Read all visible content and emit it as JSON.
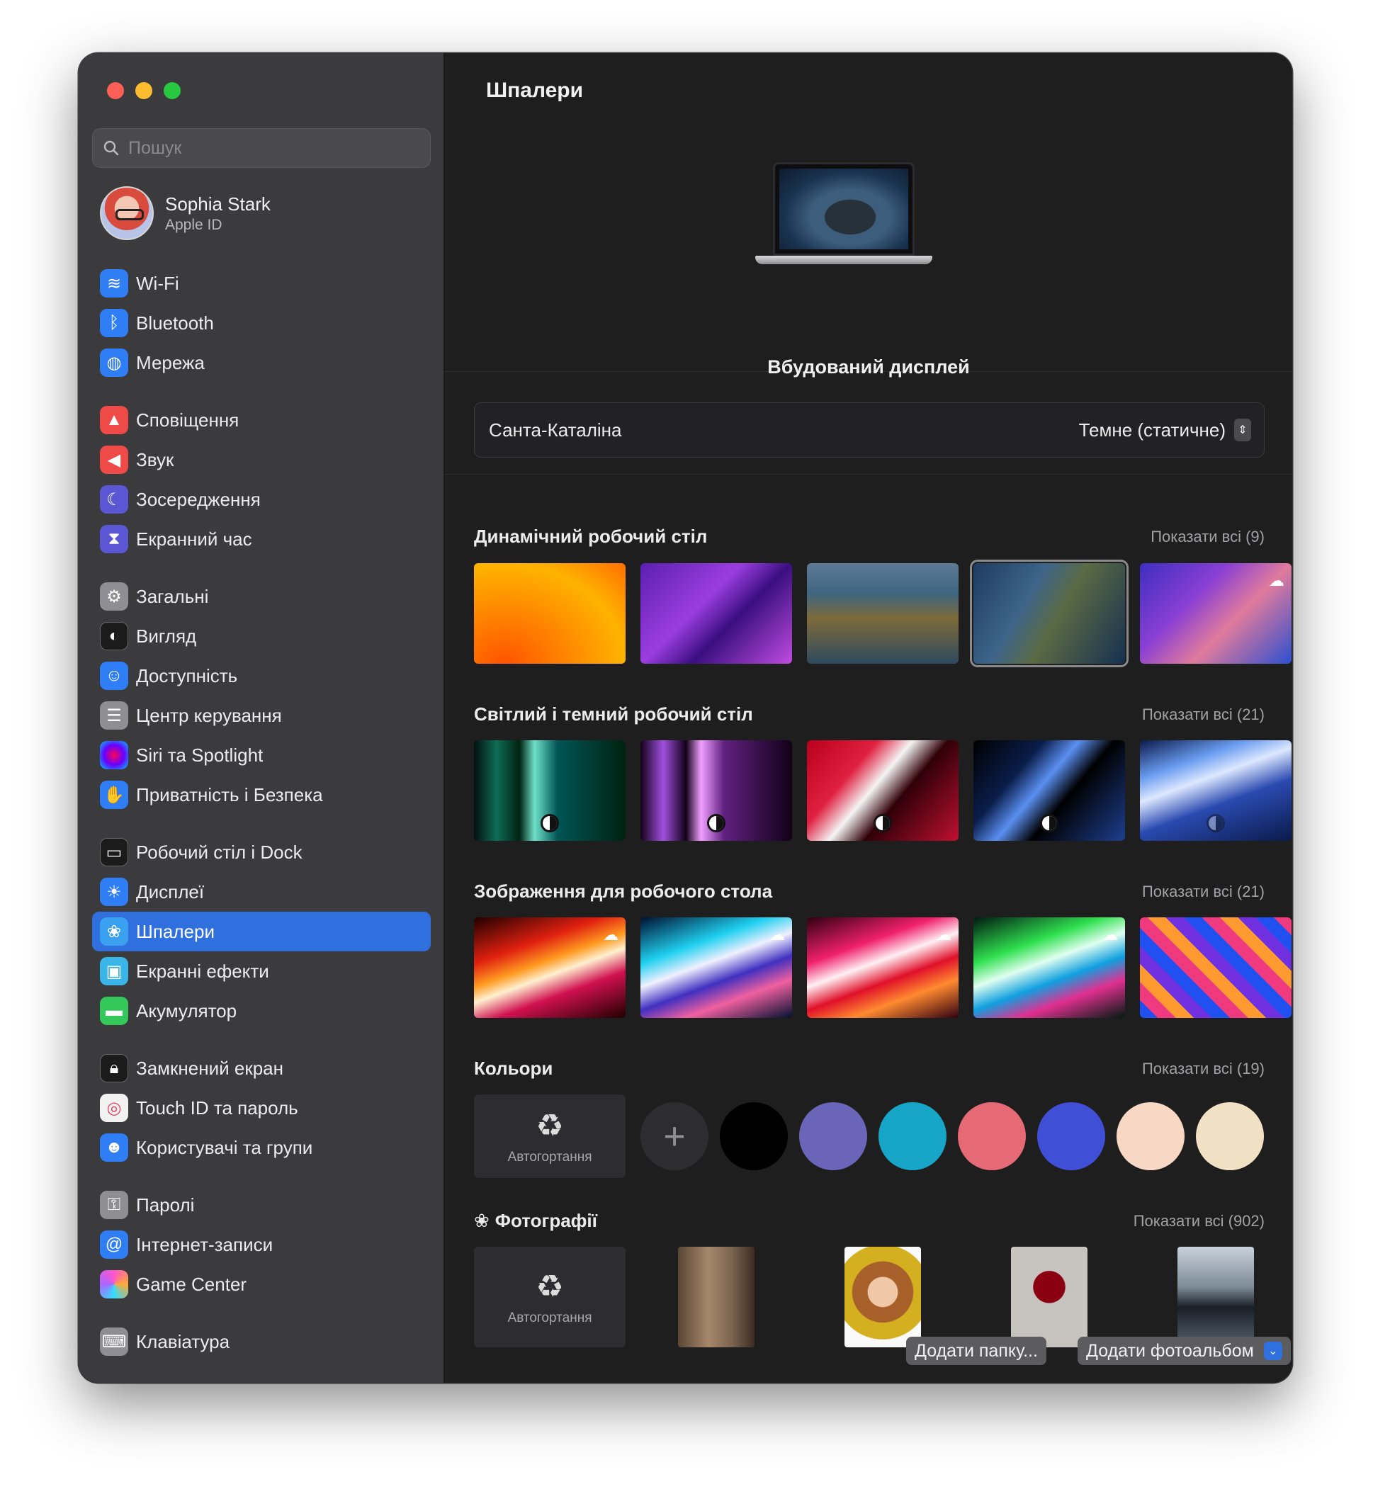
{
  "window": {
    "title": "Шпалери"
  },
  "search": {
    "placeholder": "Пошук"
  },
  "profile": {
    "name": "Sophia Stark",
    "subtitle": "Apple ID"
  },
  "sidebar": {
    "items": [
      {
        "label": "Wi-Fi",
        "icon": "wifi-icon",
        "color": "#2f7ef6"
      },
      {
        "label": "Bluetooth",
        "icon": "bluetooth-icon",
        "color": "#2f7ef6"
      },
      {
        "label": "Мережа",
        "icon": "globe-icon",
        "color": "#2f7ef6"
      },
      {
        "label": "Сповіщення",
        "icon": "bell-icon",
        "color": "#ee4a48"
      },
      {
        "label": "Звук",
        "icon": "speaker-icon",
        "color": "#ee4a48"
      },
      {
        "label": "Зосередження",
        "icon": "moon-icon",
        "color": "#5b57d4"
      },
      {
        "label": "Екранний час",
        "icon": "hourglass-icon",
        "color": "#5b57d4"
      },
      {
        "label": "Загальні",
        "icon": "gear-icon",
        "color": "#8e8e93"
      },
      {
        "label": "Вигляд",
        "icon": "appearance-icon",
        "color": "#1b1b1b"
      },
      {
        "label": "Доступність",
        "icon": "accessibility-icon",
        "color": "#2f7ef6"
      },
      {
        "label": "Центр керування",
        "icon": "control-center-icon",
        "color": "#8e8e93"
      },
      {
        "label": "Siri та Spotlight",
        "icon": "siri-icon",
        "color": "#7a3fd0"
      },
      {
        "label": "Приватність і Безпека",
        "icon": "hand-icon",
        "color": "#2f7ef6"
      },
      {
        "label": "Робочий стіл і Dock",
        "icon": "dock-icon",
        "color": "#1b1b1b"
      },
      {
        "label": "Дисплеї",
        "icon": "sun-icon",
        "color": "#2f7ef6"
      },
      {
        "label": "Шпалери",
        "icon": "flower-icon",
        "color": "#3aa0f0"
      },
      {
        "label": "Екранні ефекти",
        "icon": "screensaver-icon",
        "color": "#3ab5e8"
      },
      {
        "label": "Акумулятор",
        "icon": "battery-icon",
        "color": "#34c759"
      },
      {
        "label": "Замкнений екран",
        "icon": "lock-icon",
        "color": "#1b1b1b"
      },
      {
        "label": "Touch ID та пароль",
        "icon": "fingerprint-icon",
        "color": "#f2f2f2"
      },
      {
        "label": "Користувачі та групи",
        "icon": "users-icon",
        "color": "#2f7ef6"
      },
      {
        "label": "Паролі",
        "icon": "key-icon",
        "color": "#8e8e93"
      },
      {
        "label": "Інтернет-записи",
        "icon": "at-icon",
        "color": "#2f7ef6"
      },
      {
        "label": "Game Center",
        "icon": "gamecenter-icon",
        "color": "#f2f2f2"
      },
      {
        "label": "Клавіатура",
        "icon": "keyboard-icon",
        "color": "#8e8e93"
      }
    ],
    "active_index": 15
  },
  "preview": {
    "display_name": "Вбудований дисплей"
  },
  "wallpaper_select": {
    "name": "Санта-Каталіна",
    "mode": "Темне (статичне)"
  },
  "sections": {
    "dynamic": {
      "title": "Динамічний робочий стіл",
      "show_all": "Показати всі (9)"
    },
    "light_dark": {
      "title": "Світлий і темний робочий стіл",
      "show_all": "Показати всі (21)"
    },
    "pictures": {
      "title": "Зображення для робочого стола",
      "show_all": "Показати всі (21)"
    },
    "colors": {
      "title": "Кольори",
      "show_all": "Показати всі (19)",
      "auto_label": "Автогортання",
      "swatches": [
        "#000000",
        "#6a65b8",
        "#17a5c8",
        "#e66a75",
        "#3f4fd6",
        "#f8d7c4",
        "#f1e1c4"
      ]
    },
    "photos": {
      "title": "Фотографії",
      "show_all": "Показати всі (902)",
      "auto_label": "Автогортання"
    }
  },
  "buttons": {
    "add_folder": "Додати папку...",
    "add_album": "Додати фотоальбом",
    "help": "?"
  }
}
